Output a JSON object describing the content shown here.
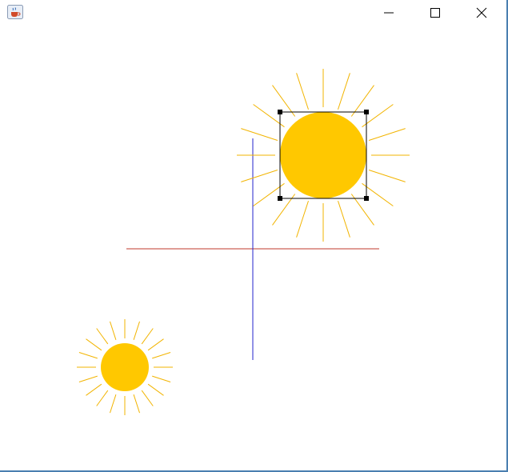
{
  "window": {
    "title": "",
    "controls": {
      "minimize": "minimize",
      "maximize": "maximize",
      "close": "close"
    }
  },
  "colors": {
    "sun_fill": "#ffc800",
    "sun_ray": "#f2b400",
    "horizontal_axis": "#c0392b",
    "vertical_axis": "#2323cc",
    "selection": "#000000"
  },
  "icons": {
    "app": "java-coffee-cup-icon",
    "minimize": "minimize-icon",
    "maximize": "maximize-icon",
    "close": "close-icon"
  },
  "scene": {
    "large_sun": {
      "selected": true,
      "ray_count": 20
    },
    "small_sun": {
      "selected": false,
      "ray_count": 20
    }
  }
}
